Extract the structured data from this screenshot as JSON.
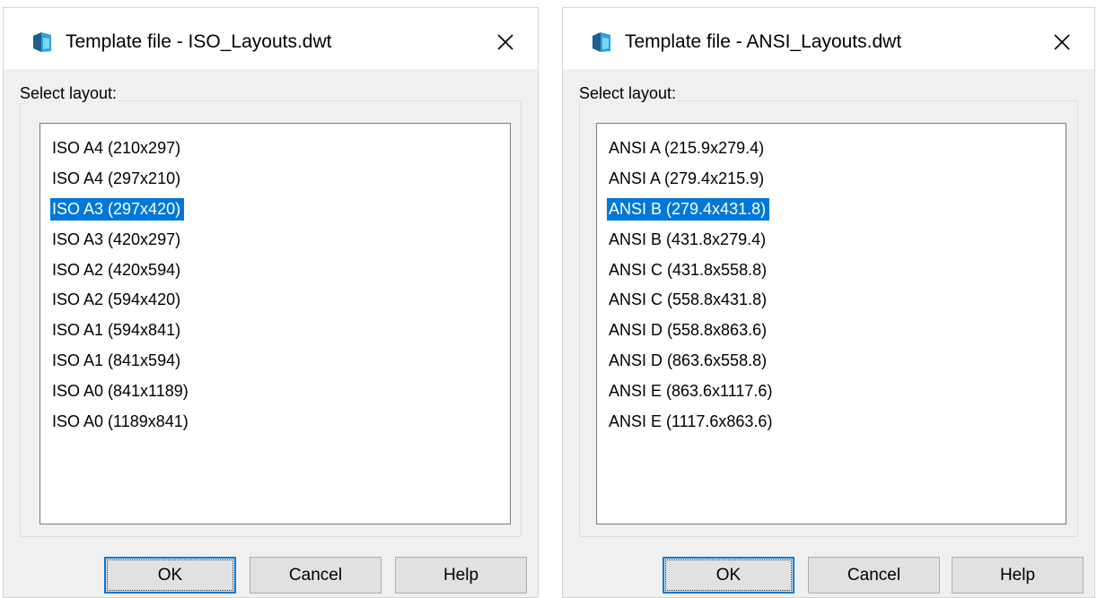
{
  "dialogs": [
    {
      "title": "Template file - ISO_Layouts.dwt",
      "group_label": "Select layout:",
      "items": [
        "ISO A4 (210x297)",
        "ISO A4 (297x210)",
        "ISO A3 (297x420)",
        "ISO A3 (420x297)",
        "ISO A2 (420x594)",
        "ISO A2 (594x420)",
        "ISO A1 (594x841)",
        "ISO A1 (841x594)",
        "ISO A0 (841x1189)",
        "ISO A0 (1189x841)"
      ],
      "selected_index": 2,
      "buttons": {
        "ok": "OK",
        "cancel": "Cancel",
        "help": "Help"
      }
    },
    {
      "title": "Template file - ANSI_Layouts.dwt",
      "group_label": "Select layout:",
      "items": [
        "ANSI A (215.9x279.4)",
        "ANSI A (279.4x215.9)",
        "ANSI B (279.4x431.8)",
        "ANSI B (431.8x279.4)",
        "ANSI C (431.8x558.8)",
        "ANSI C (558.8x431.8)",
        "ANSI D (558.8x863.6)",
        "ANSI D (863.6x558.8)",
        "ANSI E (863.6x1117.6)",
        "ANSI E (1117.6x863.6)"
      ],
      "selected_index": 2,
      "buttons": {
        "ok": "OK",
        "cancel": "Cancel",
        "help": "Help"
      }
    }
  ],
  "colors": {
    "selection": "#0078d7",
    "dialog_bg": "#f0f0f0",
    "titlebar_bg": "#ffffff"
  },
  "icons": {
    "app": "autocad-app-icon",
    "close": "close-icon"
  }
}
